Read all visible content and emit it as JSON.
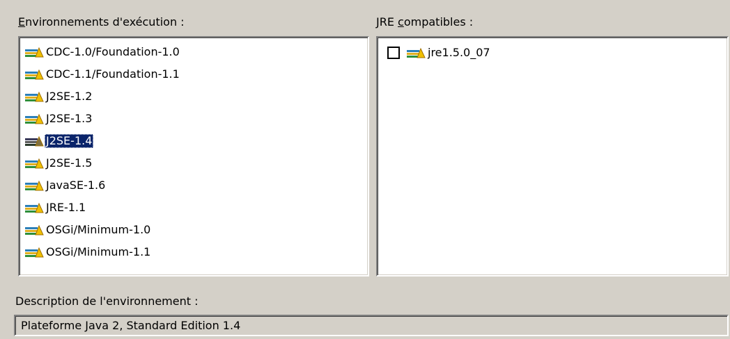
{
  "environments": {
    "label_mnemonic": "E",
    "label_rest": "nvironnements d'exécution :",
    "selected_index": 4,
    "items": [
      {
        "label": "CDC-1.0/Foundation-1.0",
        "icon": "jre-library-icon"
      },
      {
        "label": "CDC-1.1/Foundation-1.1",
        "icon": "jre-library-icon"
      },
      {
        "label": "J2SE-1.2",
        "icon": "jre-library-icon"
      },
      {
        "label": "J2SE-1.3",
        "icon": "jre-library-icon"
      },
      {
        "label": "J2SE-1.4",
        "icon": "jre-library-icon"
      },
      {
        "label": "J2SE-1.5",
        "icon": "jre-library-icon"
      },
      {
        "label": "JavaSE-1.6",
        "icon": "jre-library-icon"
      },
      {
        "label": "JRE-1.1",
        "icon": "jre-library-icon"
      },
      {
        "label": "OSGi/Minimum-1.0",
        "icon": "jre-library-icon"
      },
      {
        "label": "OSGi/Minimum-1.1",
        "icon": "jre-library-icon"
      }
    ]
  },
  "compatible_jres": {
    "label_before": "JRE ",
    "label_mnemonic": "c",
    "label_rest": "ompatibles :",
    "items": [
      {
        "label": "jre1.5.0_07",
        "checked": false,
        "icon": "jre-library-icon"
      }
    ]
  },
  "description": {
    "label": "Description de l'environnement :",
    "value": "Plateforme Java 2, Standard Edition 1.4"
  },
  "colors": {
    "background": "#d4d0c8",
    "selection": "#0a246a",
    "list_background": "#ffffff"
  }
}
